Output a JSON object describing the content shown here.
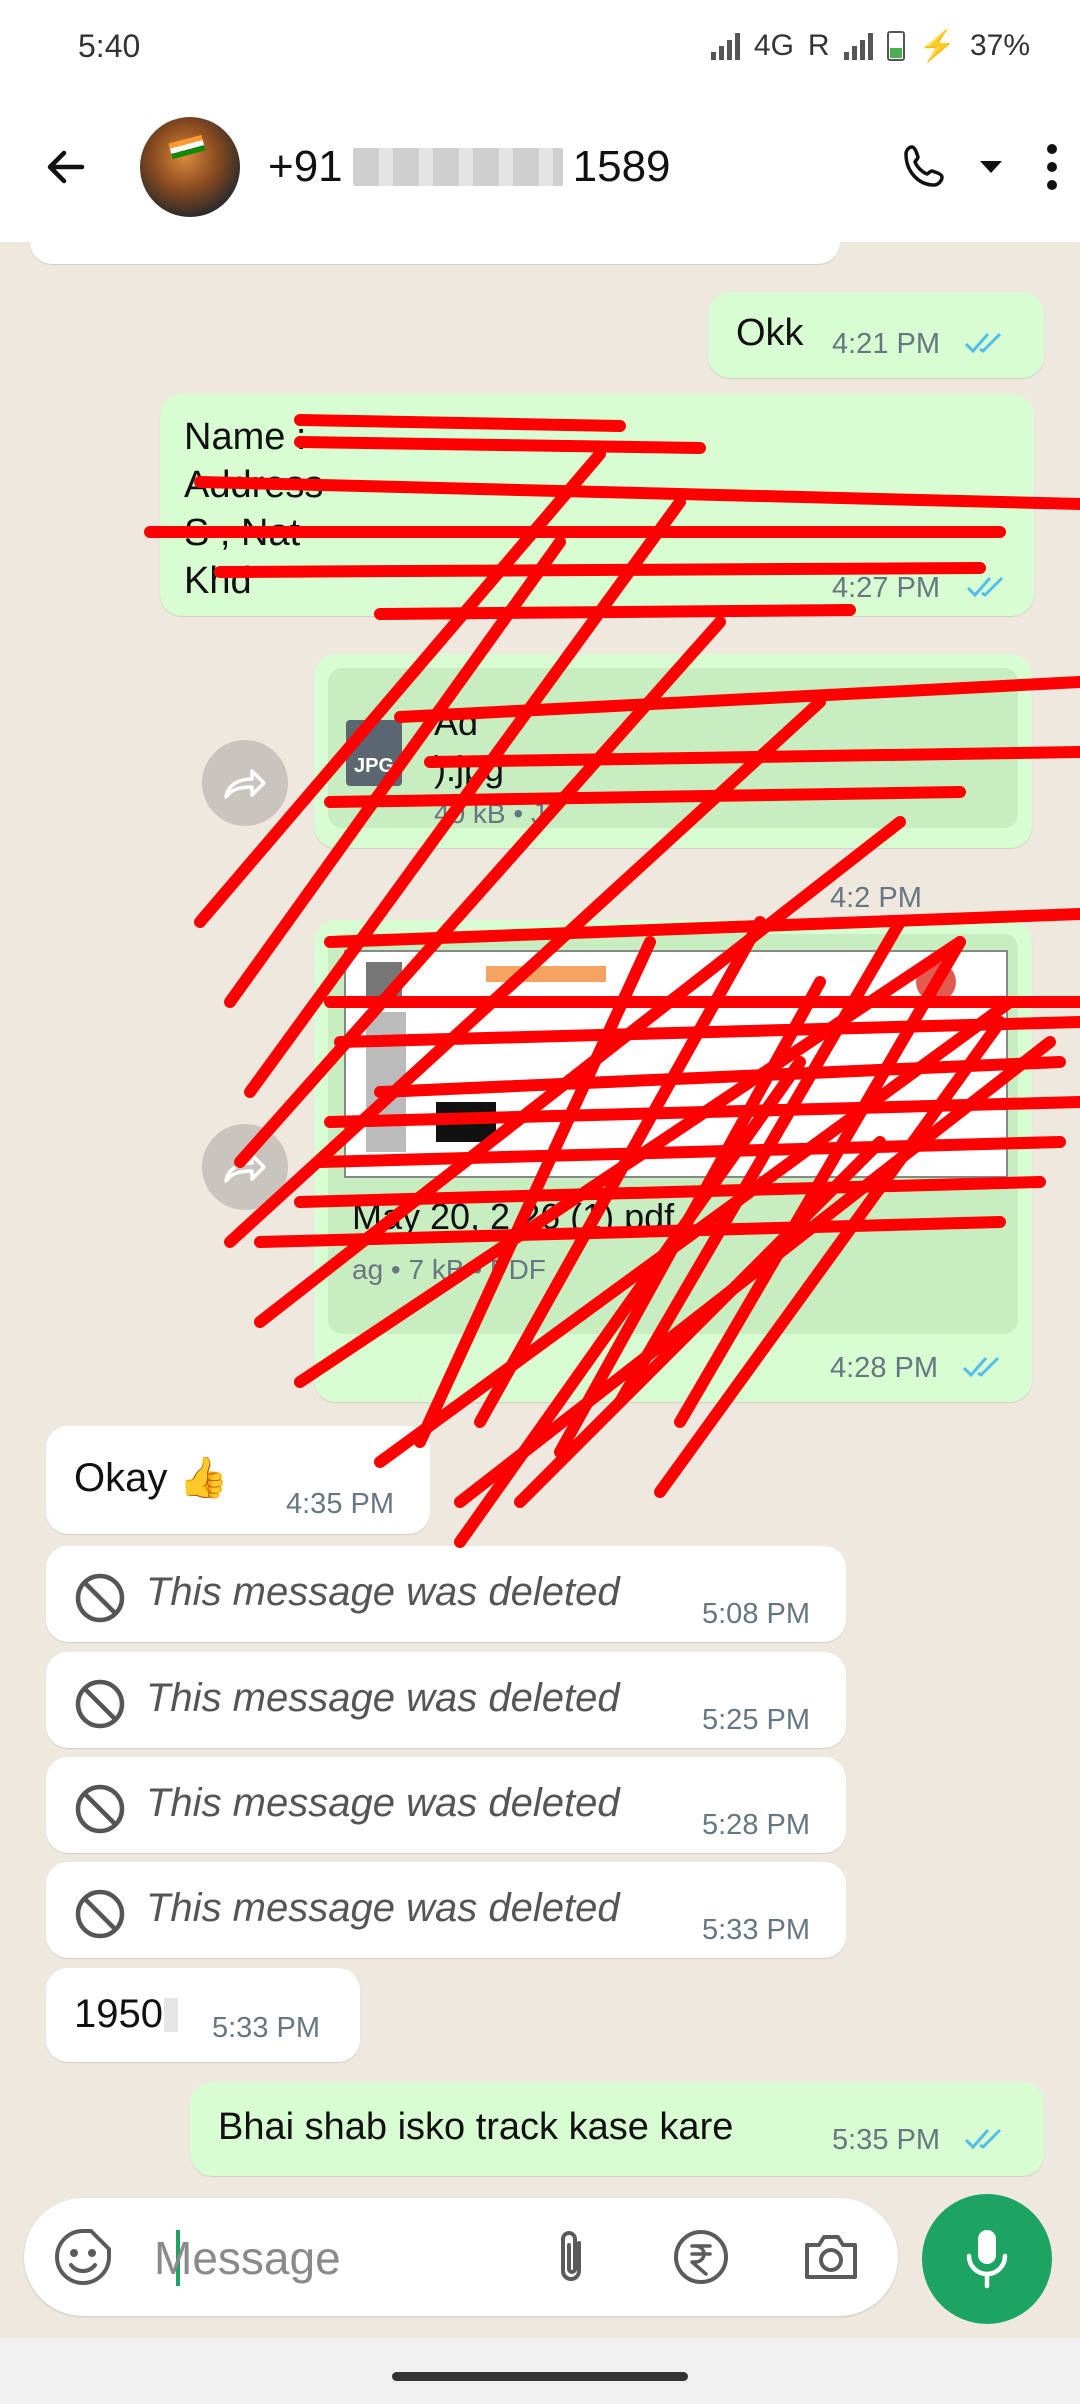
{
  "status_bar": {
    "time": "5:40",
    "network": "4G",
    "roaming": "R",
    "battery": "37%"
  },
  "header": {
    "contact_prefix": "+91",
    "contact_suffix": "1589"
  },
  "messages": [
    {
      "id": "m1",
      "direction": "out",
      "text": "Okk",
      "time": "4:21 PM",
      "status": "read"
    },
    {
      "id": "m2",
      "direction": "out",
      "text_lines": [
        "Name :",
        "Address",
        "S , Nat",
        "Khd"
      ],
      "time": "4:27 PM",
      "status": "read"
    },
    {
      "id": "m3",
      "direction": "out",
      "type": "document",
      "file_name_line1": "Ad",
      "file_name_line2": ").jpg",
      "file_meta": "40 kB • J",
      "icon_label": "JPG",
      "time": "4:2 PM",
      "status": "read"
    },
    {
      "id": "m4",
      "direction": "out",
      "type": "document",
      "file_name": "May 20, 2 26 (1) pdf",
      "file_meta": "ag • 7 kB • PDF",
      "time": "4:28 PM",
      "status": "read"
    },
    {
      "id": "m5",
      "direction": "in",
      "text": "Okay 👍",
      "time": "4:35 PM"
    },
    {
      "id": "m6",
      "direction": "in",
      "deleted": true,
      "text": "This message was deleted",
      "time": "5:08 PM"
    },
    {
      "id": "m7",
      "direction": "in",
      "deleted": true,
      "text": "This message was deleted",
      "time": "5:25 PM"
    },
    {
      "id": "m8",
      "direction": "in",
      "deleted": true,
      "text": "This message was deleted",
      "time": "5:28 PM"
    },
    {
      "id": "m9",
      "direction": "in",
      "deleted": true,
      "text": "This message was deleted",
      "time": "5:33 PM"
    },
    {
      "id": "m10",
      "direction": "in",
      "text": "1950",
      "time": "5:33 PM"
    },
    {
      "id": "m11",
      "direction": "out",
      "text": "Bhai shab isko track kase kare",
      "time": "5:35 PM",
      "status": "read"
    }
  ],
  "composer": {
    "placeholder": "Message"
  },
  "colors": {
    "outgoing_bubble": "#d9fdd3",
    "incoming_bubble": "#ffffff",
    "accent": "#1da462",
    "read_ticks": "#53bdeb",
    "redaction": "#ff0000"
  }
}
